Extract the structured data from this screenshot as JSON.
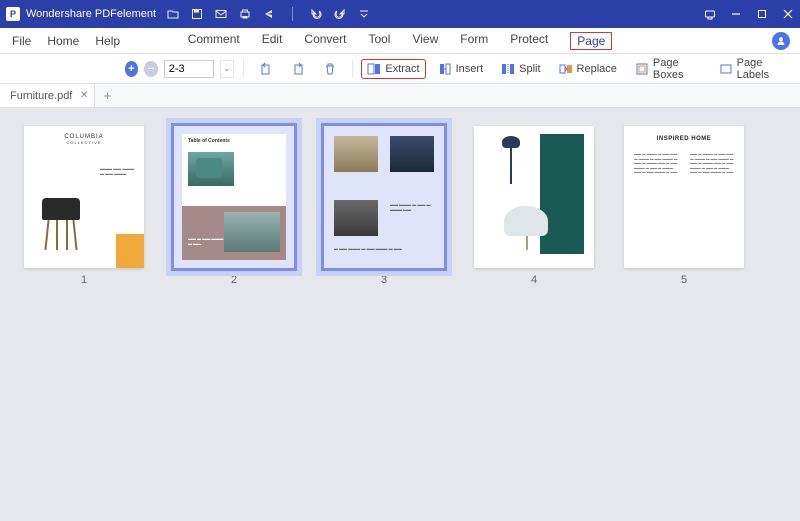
{
  "app": {
    "name": "Wondershare PDFelement"
  },
  "menubar": {
    "left": [
      "File",
      "Home",
      "Help"
    ],
    "center": [
      "Comment",
      "Edit",
      "Convert",
      "Tool",
      "View",
      "Form",
      "Protect",
      "Page"
    ],
    "highlighted": "Page"
  },
  "toolbar": {
    "page_input": "2-3",
    "actions": {
      "extract": "Extract",
      "insert": "Insert",
      "split": "Split",
      "replace": "Replace",
      "pageboxes": "Page Boxes",
      "pagelabels": "Page Labels"
    },
    "highlighted": "Extract"
  },
  "tabbar": {
    "active_tab": "Furniture.pdf"
  },
  "pages": [
    {
      "num": "1",
      "selected": false,
      "headline": "COLUMBIA",
      "subhead": "COLLECTIVE"
    },
    {
      "num": "2",
      "selected": true,
      "headline": "Table of Contents"
    },
    {
      "num": "3",
      "selected": true
    },
    {
      "num": "4",
      "selected": false
    },
    {
      "num": "5",
      "selected": false,
      "headline": "INSPIRED HOME"
    }
  ],
  "colors": {
    "brand": "#2b3fa8",
    "highlight": "#d13a2a",
    "select": "#7a8ef0"
  }
}
